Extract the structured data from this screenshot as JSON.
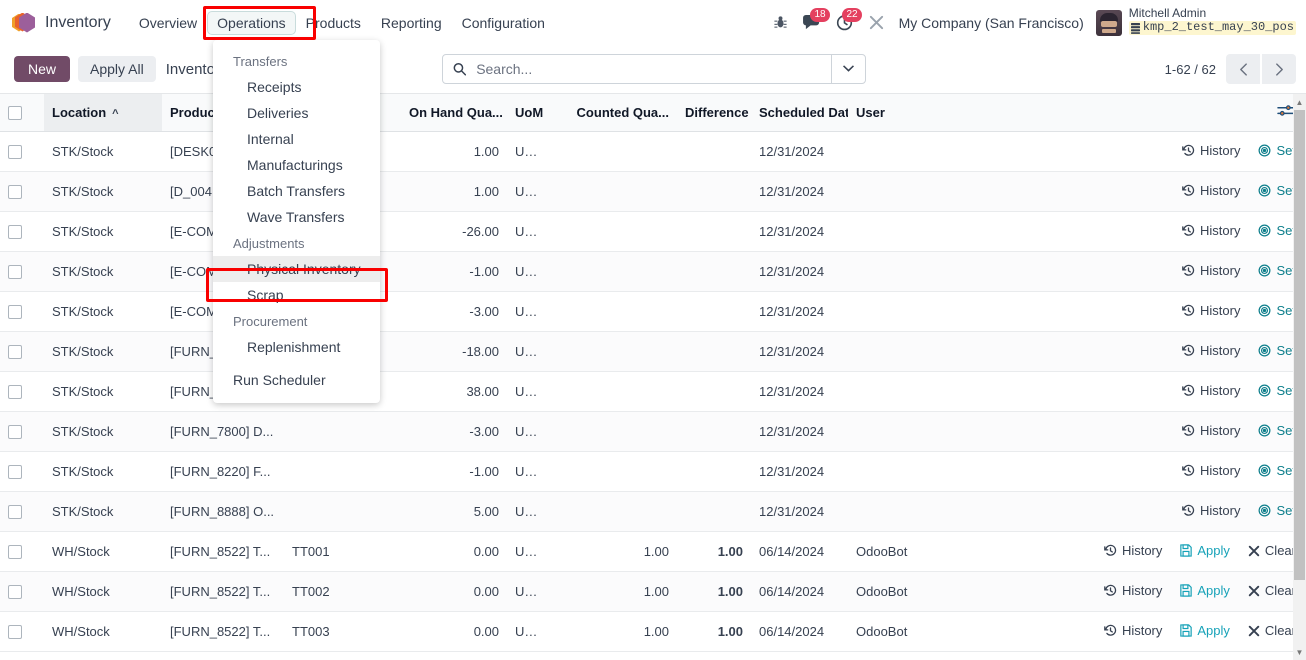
{
  "navbar": {
    "app_name": "Inventory",
    "menu": [
      {
        "label": "Overview",
        "active": false
      },
      {
        "label": "Operations",
        "active": true
      },
      {
        "label": "Products",
        "active": false
      },
      {
        "label": "Reporting",
        "active": false
      },
      {
        "label": "Configuration",
        "active": false
      }
    ],
    "debug_icon": "bug-icon",
    "messages_icon": "chat-bubble-icon",
    "messages_count": "18",
    "activities_icon": "clock-icon",
    "activities_count": "22",
    "tools_icon": "wrench-icon",
    "company": "My Company (San Francisco)",
    "user_name": "Mitchell Admin",
    "database": "kmp_2_test_may_30_pos",
    "database_icon": "database-icon"
  },
  "dropdown": {
    "sections": [
      {
        "title": "Transfers",
        "items": [
          {
            "label": "Receipts",
            "highlighted": false
          },
          {
            "label": "Deliveries",
            "highlighted": false
          },
          {
            "label": "Internal",
            "highlighted": false
          },
          {
            "label": "Manufacturings",
            "highlighted": false
          },
          {
            "label": "Batch Transfers",
            "highlighted": false
          },
          {
            "label": "Wave Transfers",
            "highlighted": false
          }
        ]
      },
      {
        "title": "Adjustments",
        "items": [
          {
            "label": "Physical Inventory",
            "highlighted": true
          },
          {
            "label": "Scrap",
            "highlighted": false
          }
        ]
      },
      {
        "title": "Procurement",
        "items": [
          {
            "label": "Replenishment",
            "highlighted": false
          }
        ]
      }
    ],
    "root_item": "Run Scheduler"
  },
  "control_panel": {
    "new_label": "New",
    "apply_all_label": "Apply All",
    "breadcrumb": "Inventory Adjustments",
    "search_placeholder": "Search...",
    "search_value": "",
    "search_icon": "search-icon",
    "search_toggle_icon": "chevron-down-icon",
    "pager_count": "1-62 / 62",
    "pager_prev_icon": "chevron-left-icon",
    "pager_next_icon": "chevron-right-icon"
  },
  "table": {
    "options_icon": "column-settings-icon",
    "sort_icon": "caret-up-icon",
    "columns": [
      {
        "key": "checkbox",
        "label": ""
      },
      {
        "key": "location",
        "label": "Location",
        "sorted": true
      },
      {
        "key": "product",
        "label": "Product"
      },
      {
        "key": "lot",
        "label": "..."
      },
      {
        "key": "on_hand",
        "label": "On Hand Qua...",
        "align": "right"
      },
      {
        "key": "uom",
        "label": "UoM"
      },
      {
        "key": "counted",
        "label": "Counted Qua...",
        "align": "right"
      },
      {
        "key": "difference",
        "label": "Difference",
        "align": "right"
      },
      {
        "key": "scheduled_date",
        "label": "Scheduled Date"
      },
      {
        "key": "user",
        "label": "User"
      },
      {
        "key": "actions",
        "label": ""
      }
    ],
    "rows": [
      {
        "location": "STK/Stock",
        "product": "[DESK0...",
        "lot": "",
        "on_hand": "1.00",
        "negative": false,
        "uom": "Un...",
        "counted": "",
        "difference": "",
        "scheduled_date": "12/31/2024",
        "user": "",
        "actions": [
          "History",
          "Set"
        ]
      },
      {
        "location": "STK/Stock",
        "product": "[D_004...",
        "lot": "",
        "on_hand": "1.00",
        "negative": false,
        "uom": "Un...",
        "counted": "",
        "difference": "",
        "scheduled_date": "12/31/2024",
        "user": "",
        "actions": [
          "History",
          "Set"
        ]
      },
      {
        "location": "STK/Stock",
        "product": "[E-COM...",
        "lot": "",
        "on_hand": "-26.00",
        "negative": true,
        "uom": "Un...",
        "counted": "",
        "difference": "",
        "scheduled_date": "12/31/2024",
        "user": "",
        "actions": [
          "History",
          "Set"
        ]
      },
      {
        "location": "STK/Stock",
        "product": "[E-COM...",
        "lot": "",
        "on_hand": "-1.00",
        "negative": true,
        "uom": "Un...",
        "counted": "",
        "difference": "",
        "scheduled_date": "12/31/2024",
        "user": "",
        "actions": [
          "History",
          "Set"
        ]
      },
      {
        "location": "STK/Stock",
        "product": "[E-COM...",
        "lot": "",
        "on_hand": "-3.00",
        "negative": true,
        "uom": "Un...",
        "counted": "",
        "difference": "",
        "scheduled_date": "12/31/2024",
        "user": "",
        "actions": [
          "History",
          "Set"
        ]
      },
      {
        "location": "STK/Stock",
        "product": "[FURN_...",
        "lot": "",
        "on_hand": "-18.00",
        "negative": true,
        "uom": "Un...",
        "counted": "",
        "difference": "",
        "scheduled_date": "12/31/2024",
        "user": "",
        "actions": [
          "History",
          "Set"
        ]
      },
      {
        "location": "STK/Stock",
        "product": "[FURN_...",
        "lot": "",
        "on_hand": "38.00",
        "negative": false,
        "uom": "Un...",
        "counted": "",
        "difference": "",
        "scheduled_date": "12/31/2024",
        "user": "",
        "actions": [
          "History",
          "Set"
        ]
      },
      {
        "location": "STK/Stock",
        "product": "[FURN_7800] D...",
        "lot": "",
        "on_hand": "-3.00",
        "negative": true,
        "uom": "Un...",
        "counted": "",
        "difference": "",
        "scheduled_date": "12/31/2024",
        "user": "",
        "actions": [
          "History",
          "Set"
        ]
      },
      {
        "location": "STK/Stock",
        "product": "[FURN_8220] F...",
        "lot": "",
        "on_hand": "-1.00",
        "negative": true,
        "uom": "Un...",
        "counted": "",
        "difference": "",
        "scheduled_date": "12/31/2024",
        "user": "",
        "actions": [
          "History",
          "Set"
        ]
      },
      {
        "location": "STK/Stock",
        "product": "[FURN_8888] O...",
        "lot": "",
        "on_hand": "5.00",
        "negative": false,
        "uom": "Un...",
        "counted": "",
        "difference": "",
        "scheduled_date": "12/31/2024",
        "user": "",
        "actions": [
          "History",
          "Set"
        ]
      },
      {
        "location": "WH/Stock",
        "product": "[FURN_8522] T...",
        "lot": "TT001",
        "on_hand": "0.00",
        "negative": false,
        "uom": "Un...",
        "counted": "1.00",
        "difference": "1.00",
        "scheduled_date": "06/14/2024",
        "user": "OdooBot",
        "actions": [
          "History",
          "Apply",
          "Clear"
        ]
      },
      {
        "location": "WH/Stock",
        "product": "[FURN_8522] T...",
        "lot": "TT002",
        "on_hand": "0.00",
        "negative": false,
        "uom": "Un...",
        "counted": "1.00",
        "difference": "1.00",
        "scheduled_date": "06/14/2024",
        "user": "OdooBot",
        "actions": [
          "History",
          "Apply",
          "Clear"
        ]
      },
      {
        "location": "WH/Stock",
        "product": "[FURN_8522] T...",
        "lot": "TT003",
        "on_hand": "0.00",
        "negative": false,
        "uom": "Un...",
        "counted": "1.00",
        "difference": "1.00",
        "scheduled_date": "06/14/2024",
        "user": "OdooBot",
        "actions": [
          "History",
          "Apply",
          "Clear"
        ]
      }
    ],
    "action_icons": {
      "History": "history-icon",
      "Set": "target-icon",
      "Apply": "save-icon",
      "Clear": "x-icon"
    }
  },
  "annotations": {
    "operations_highlight_color": "#f90000",
    "physical_inventory_highlight_color": "#f90000"
  },
  "colors": {
    "primary": "#714b67",
    "negative": "#c98b16",
    "positive": "#1a8a37",
    "link": "#17a2b8",
    "badge": "#e4405f"
  }
}
